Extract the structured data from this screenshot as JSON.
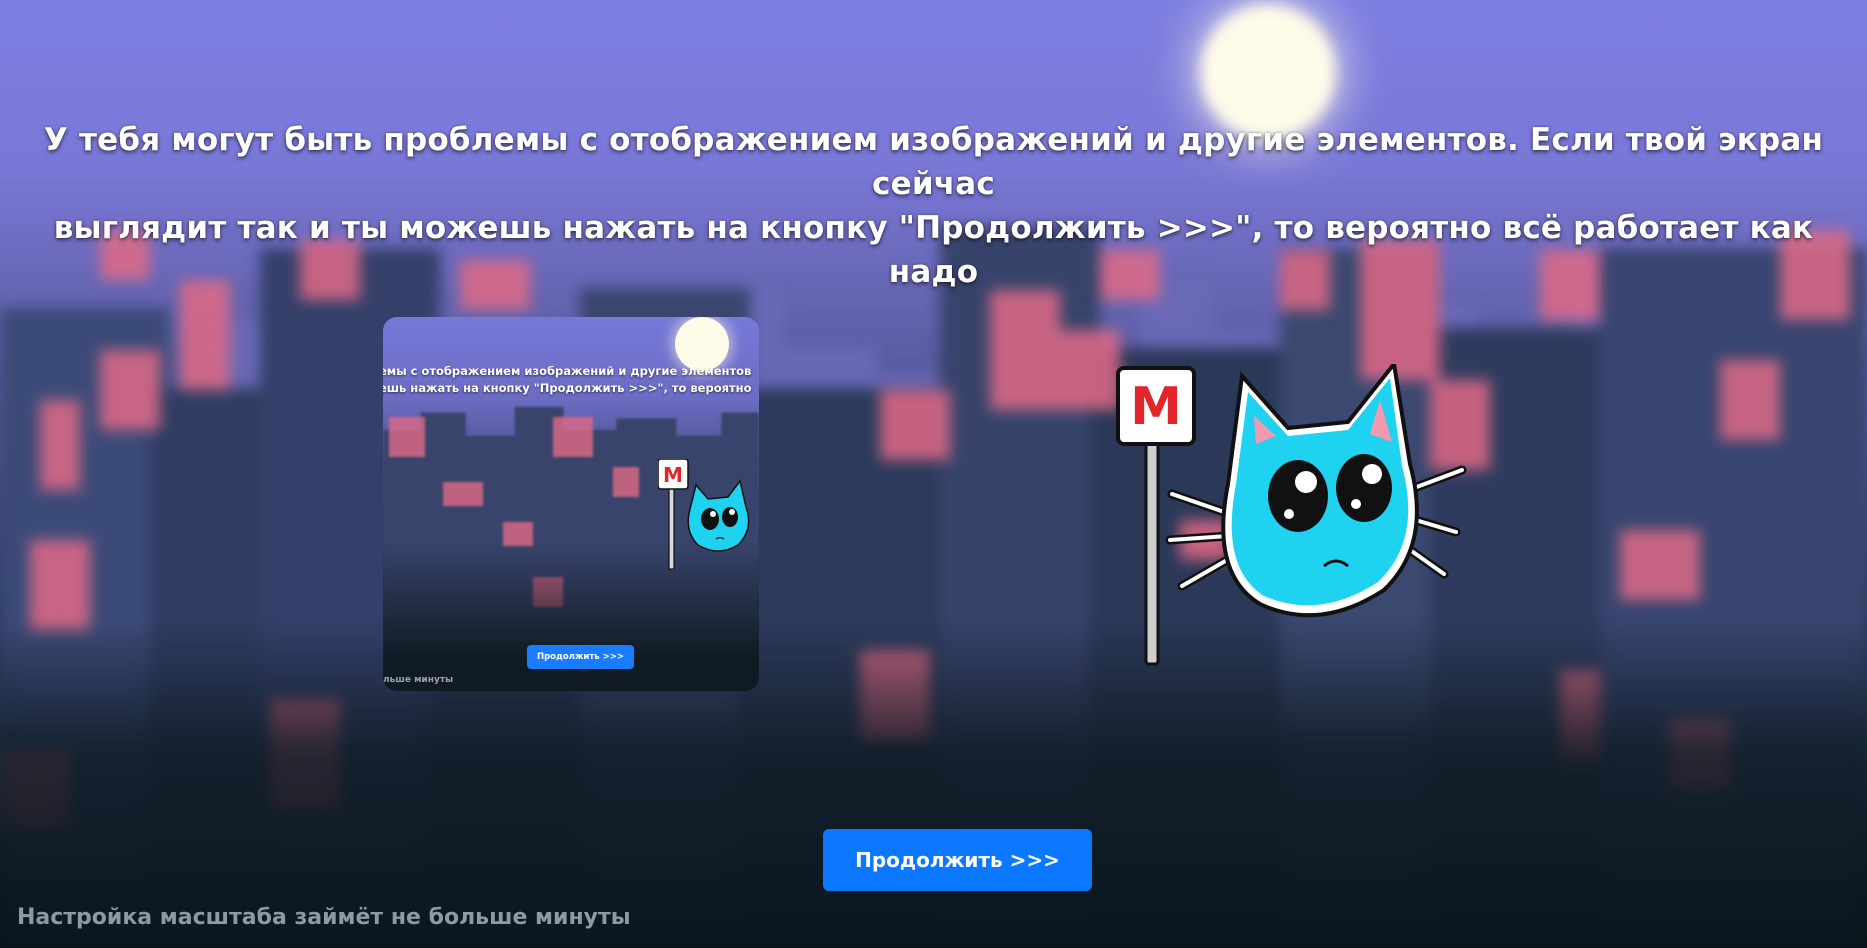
{
  "headline": {
    "line1": "У тебя могут быть проблемы с отображением изображений и другие элементов. Если твой экран сейчас",
    "line2": "выглядит так и ты можешь нажать на кнопку \"Продолжить >>>\", то вероятно всё работает как надо"
  },
  "preview": {
    "line1": "емы с отображением изображений и другие элементов",
    "line2": "ешь нажать на кнопку \"Продолжить >>>\", то вероятно",
    "button_label": "Продолжить >>>",
    "footer": "льше минуты",
    "metro_letter": "M"
  },
  "mascot": {
    "metro_letter": "M"
  },
  "continue_button": {
    "label": "Продолжить >>>"
  },
  "footer_note": "Настройка масштаба займёт не больше минуты",
  "colors": {
    "accent": "#0b78ff",
    "sky_top": "#7d7fe2",
    "window": "#e06a86",
    "cat": "#1fd3f0"
  }
}
